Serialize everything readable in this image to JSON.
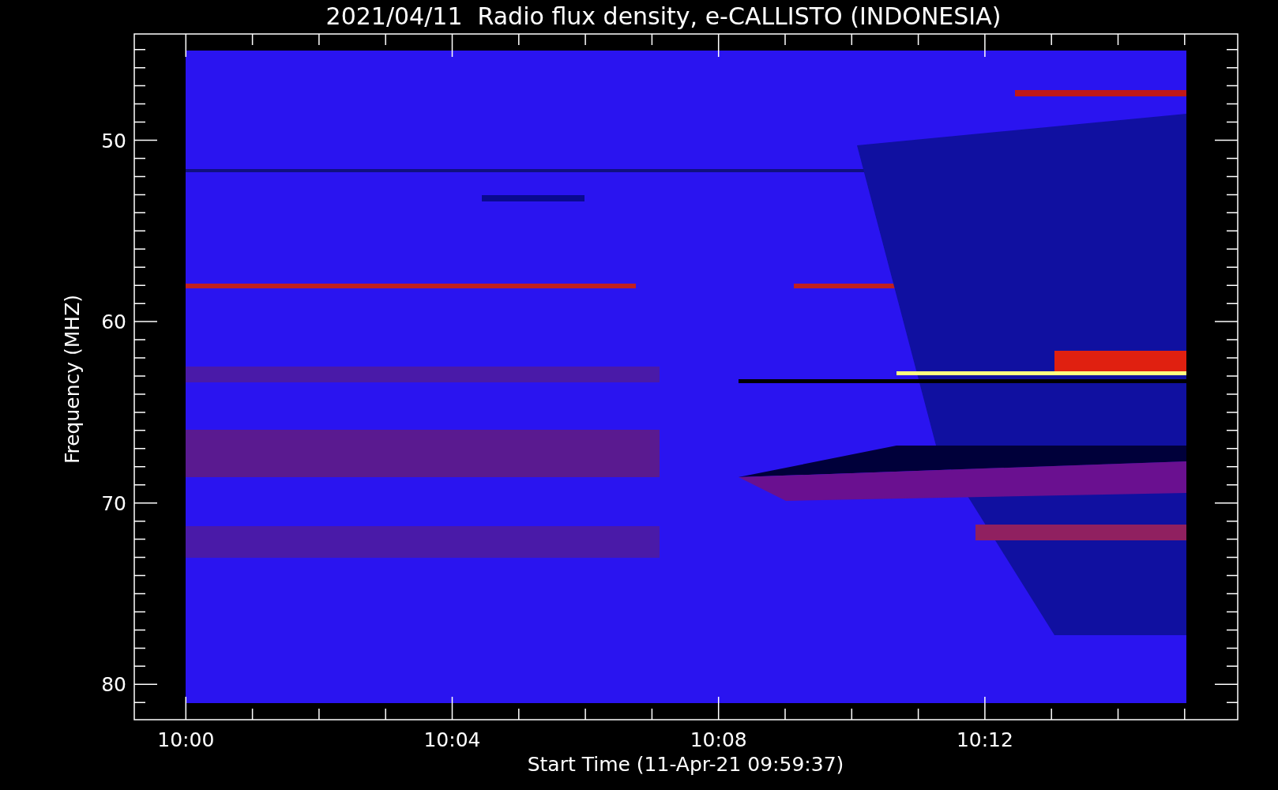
{
  "title": "2021/04/11  Radio flux density, e-CALLISTO (INDONESIA)",
  "ylabel": "Frequency (MHZ)",
  "xlabel": "Start Time (11-Apr-21 09:59:37)",
  "yticks": [
    "50",
    "60",
    "70",
    "80"
  ],
  "xticks": [
    "10:00",
    "10:04",
    "10:08",
    "10:12"
  ]
}
